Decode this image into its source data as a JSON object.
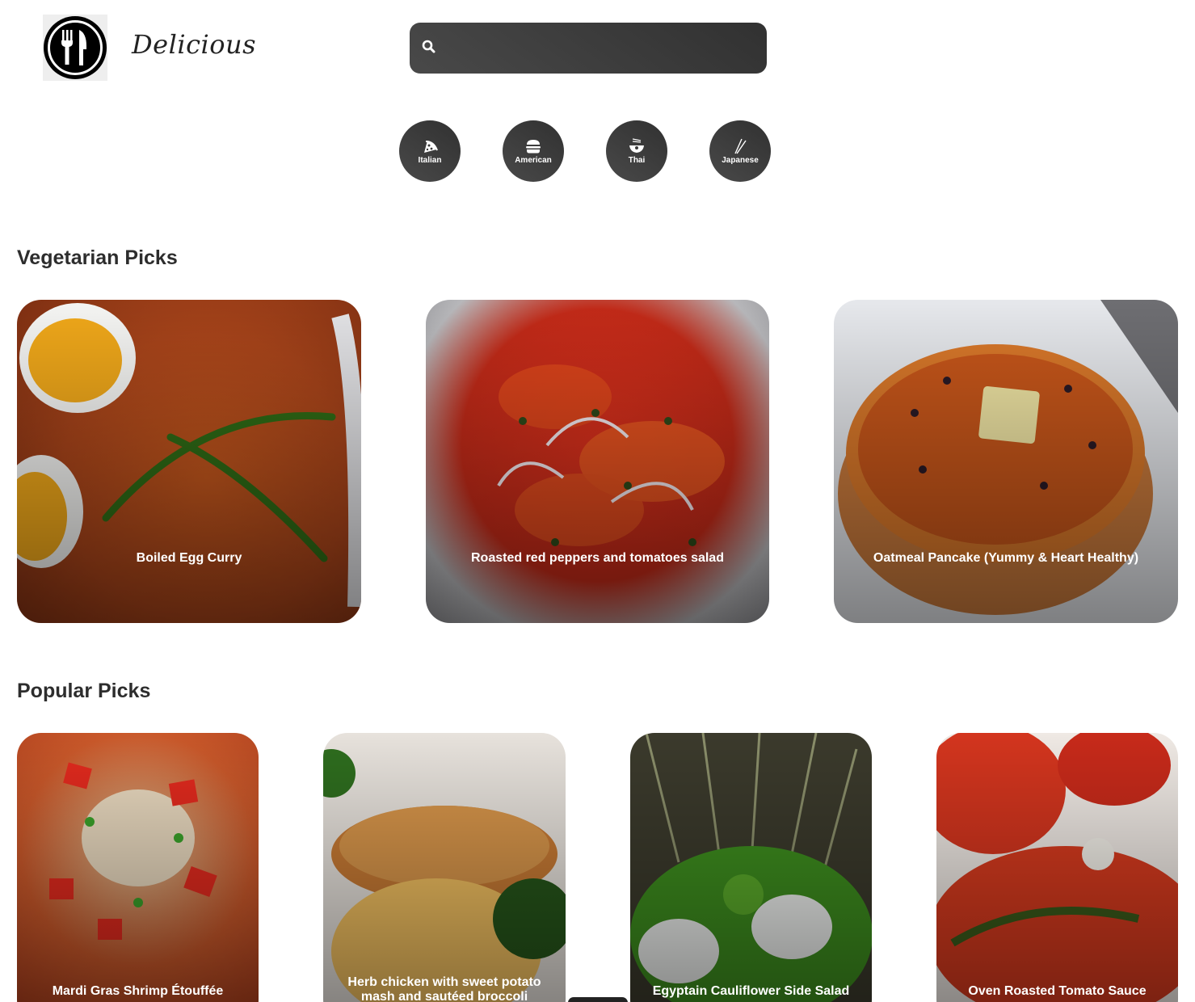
{
  "brand": {
    "name": "Delicious"
  },
  "search": {
    "value": "",
    "placeholder": ""
  },
  "categories": [
    {
      "label": "Italian",
      "icon": "pizza-icon"
    },
    {
      "label": "American",
      "icon": "burger-icon"
    },
    {
      "label": "Thai",
      "icon": "noodle-bowl-icon"
    },
    {
      "label": "Japanese",
      "icon": "chopsticks-icon"
    }
  ],
  "vegetarian": {
    "heading": "Vegetarian Picks",
    "items": [
      {
        "title": "Boiled Egg Curry"
      },
      {
        "title": "Roasted red peppers and tomatoes salad"
      },
      {
        "title": "Oatmeal Pancake (Yummy & Heart Healthy)"
      }
    ]
  },
  "popular": {
    "heading": "Popular Picks",
    "items": [
      {
        "title": "Mardi Gras Shrimp Étouffée"
      },
      {
        "title": "Herb chicken with sweet potato mash and sautéed broccoli"
      },
      {
        "title": "Egyptain Cauliflower Side Salad"
      },
      {
        "title": "Oven Roasted Tomato Sauce"
      }
    ]
  },
  "colors": {
    "accent_dark": "#313131",
    "accent_light": "#494949",
    "text": "#2d2d2d"
  }
}
